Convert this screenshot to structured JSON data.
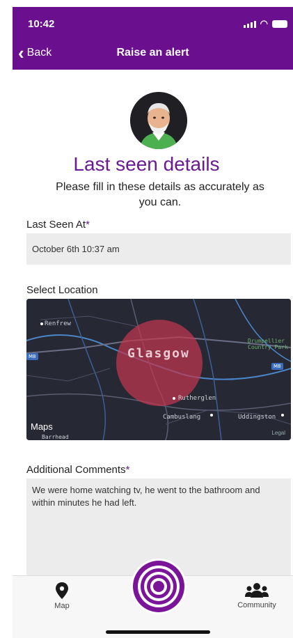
{
  "status_bar": {
    "time": "10:42"
  },
  "nav": {
    "back_label": "Back",
    "title": "Raise an alert"
  },
  "heading": {
    "title": "Last seen details",
    "subtitle": "Please fill in these details as accurately as you can."
  },
  "last_seen": {
    "label": "Last Seen At",
    "required_mark": "*",
    "value": "October 6th 10:37 am"
  },
  "location": {
    "label": "Select Location",
    "map": {
      "city": "Glasgow",
      "places": [
        "Renfrew",
        "Rutherglen",
        "Cambuslang",
        "Uddingston",
        "Drumpellier Country Park",
        "Barrhead"
      ],
      "road_badges": [
        "M8",
        "M8"
      ],
      "brand": "Maps",
      "legal": "Legal",
      "colors": {
        "background": "#262833",
        "radius_circle": "#c2364f"
      }
    }
  },
  "comments": {
    "label": "Additional Comments",
    "required_mark": "*",
    "value": "We were home watching tv, he went to the bathroom and within minutes he had left."
  },
  "tabbar": {
    "items": [
      {
        "label": "Map",
        "icon": "location-pin-icon"
      },
      {
        "label": "",
        "icon": "alert-target-icon"
      },
      {
        "label": "Community",
        "icon": "community-icon"
      }
    ]
  },
  "theme": {
    "primary": "#6a0f8e",
    "accent_text": "#6a1b93"
  }
}
